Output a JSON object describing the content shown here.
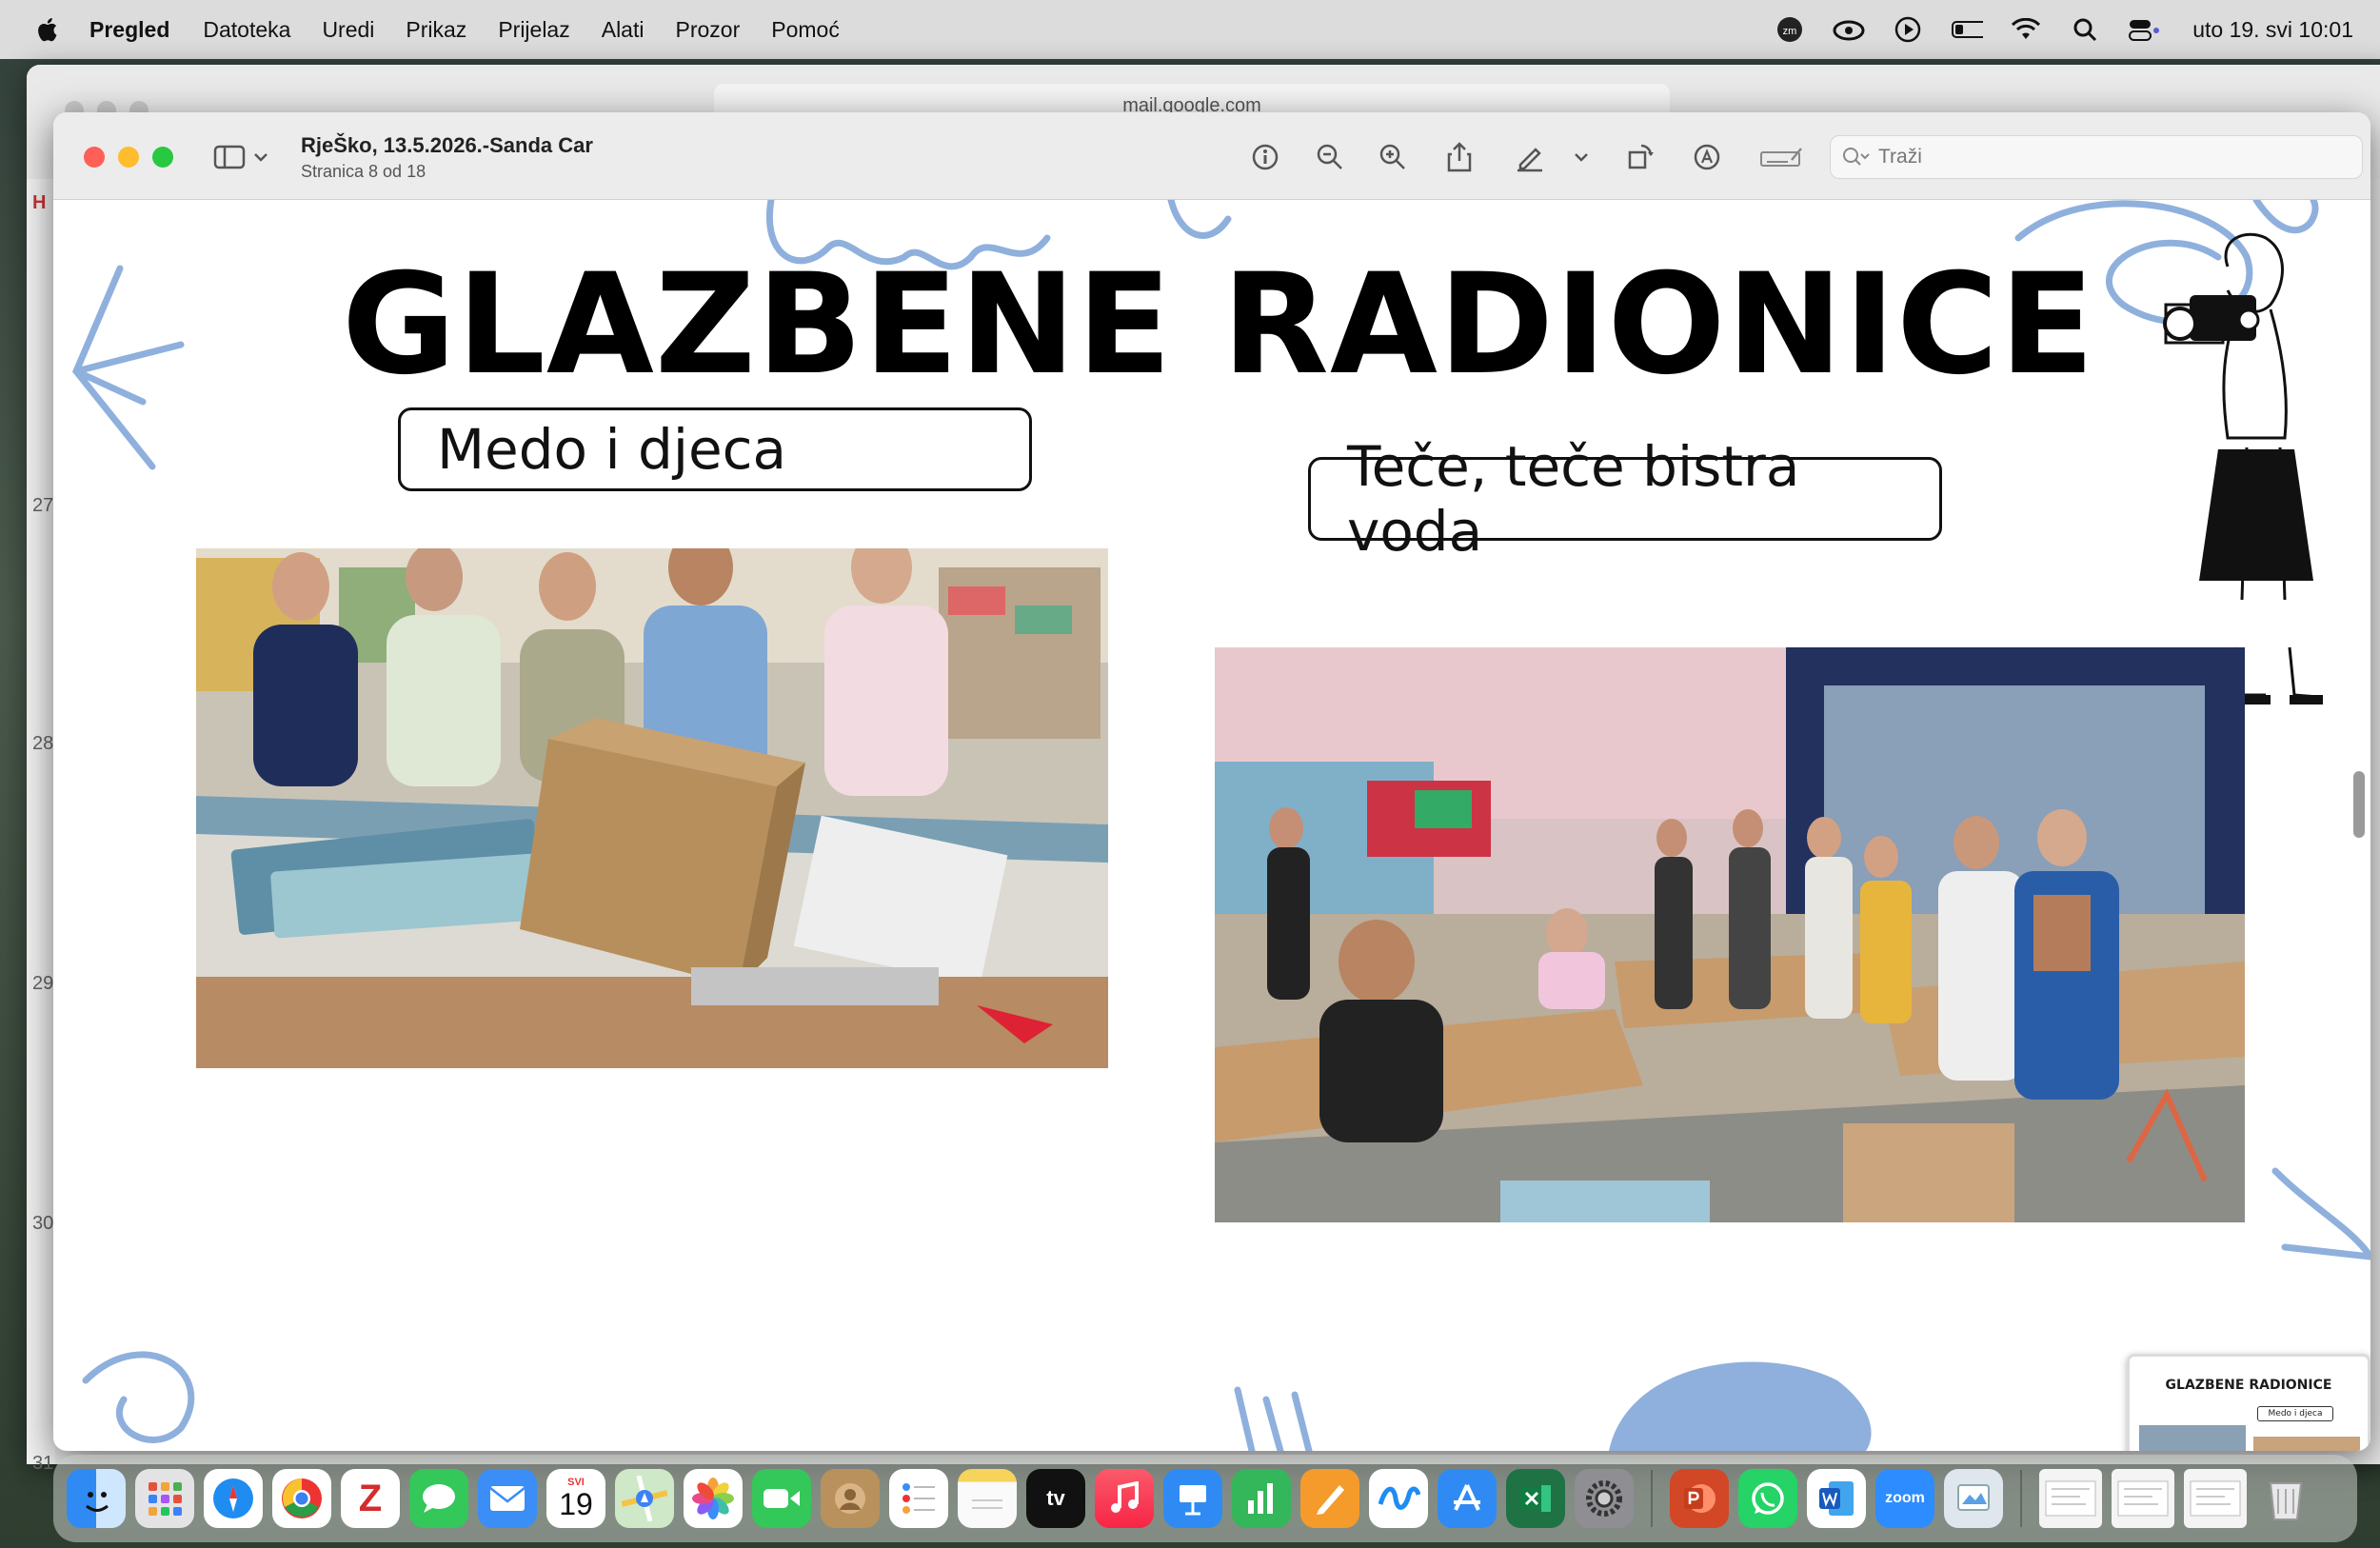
{
  "menubar": {
    "app": "Pregled",
    "items": [
      "Datoteka",
      "Uredi",
      "Prikaz",
      "Prijelaz",
      "Alati",
      "Prozor",
      "Pomoć"
    ],
    "clock": "uto 19. svi  10:01"
  },
  "safari": {
    "url": "mail.google.com",
    "side_letter": "H",
    "side_dates": [
      "27",
      "28",
      "29",
      "30",
      "31"
    ]
  },
  "preview": {
    "title": "RjeŠko, 13.5.2026.-Sanda Car",
    "subtitle": "Stranica 8 od 18",
    "search_placeholder": "Traži"
  },
  "slide": {
    "title": "GLAZBENE RADIONICE",
    "label_left": "Medo i djeca",
    "label_right": "Teče, teče bistra voda",
    "accent_color": "#8fb0dc"
  },
  "thumbnail": {
    "title": "GLAZBENE RADIONICE",
    "label_a": "Medo i djeca"
  },
  "dock": {
    "calendar_month": "SVI",
    "calendar_day": "19",
    "tv_label": "tv",
    "zoom_label": "zoom",
    "items": [
      "finder",
      "launchpad",
      "safari",
      "chrome",
      "zotero",
      "messages",
      "mail",
      "calendar",
      "maps",
      "photos",
      "facetime",
      "contacts",
      "reminders",
      "notes",
      "apple-tv",
      "music",
      "keynote",
      "numbers",
      "pages",
      "freeform",
      "app-store",
      "excel",
      "system-settings",
      "powerpoint",
      "whatsapp",
      "word",
      "zoom",
      "preview",
      "recent-doc-1",
      "recent-doc-2",
      "recent-doc-3",
      "trash"
    ]
  }
}
